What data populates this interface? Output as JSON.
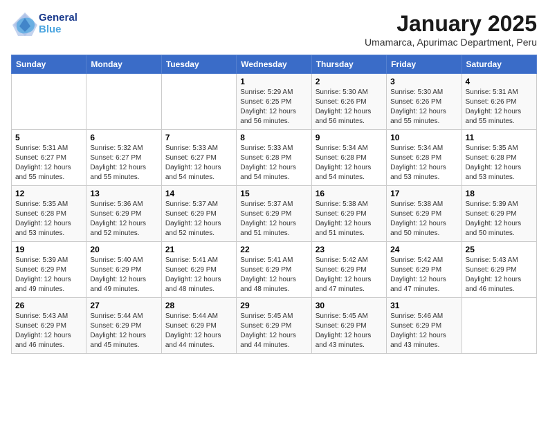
{
  "logo": {
    "line1": "General",
    "line2": "Blue"
  },
  "title": "January 2025",
  "subtitle": "Umamarca, Apurimac Department, Peru",
  "days_of_week": [
    "Sunday",
    "Monday",
    "Tuesday",
    "Wednesday",
    "Thursday",
    "Friday",
    "Saturday"
  ],
  "weeks": [
    [
      {
        "day": "",
        "detail": ""
      },
      {
        "day": "",
        "detail": ""
      },
      {
        "day": "",
        "detail": ""
      },
      {
        "day": "1",
        "detail": "Sunrise: 5:29 AM\nSunset: 6:25 PM\nDaylight: 12 hours\nand 56 minutes."
      },
      {
        "day": "2",
        "detail": "Sunrise: 5:30 AM\nSunset: 6:26 PM\nDaylight: 12 hours\nand 56 minutes."
      },
      {
        "day": "3",
        "detail": "Sunrise: 5:30 AM\nSunset: 6:26 PM\nDaylight: 12 hours\nand 55 minutes."
      },
      {
        "day": "4",
        "detail": "Sunrise: 5:31 AM\nSunset: 6:26 PM\nDaylight: 12 hours\nand 55 minutes."
      }
    ],
    [
      {
        "day": "5",
        "detail": "Sunrise: 5:31 AM\nSunset: 6:27 PM\nDaylight: 12 hours\nand 55 minutes."
      },
      {
        "day": "6",
        "detail": "Sunrise: 5:32 AM\nSunset: 6:27 PM\nDaylight: 12 hours\nand 55 minutes."
      },
      {
        "day": "7",
        "detail": "Sunrise: 5:33 AM\nSunset: 6:27 PM\nDaylight: 12 hours\nand 54 minutes."
      },
      {
        "day": "8",
        "detail": "Sunrise: 5:33 AM\nSunset: 6:28 PM\nDaylight: 12 hours\nand 54 minutes."
      },
      {
        "day": "9",
        "detail": "Sunrise: 5:34 AM\nSunset: 6:28 PM\nDaylight: 12 hours\nand 54 minutes."
      },
      {
        "day": "10",
        "detail": "Sunrise: 5:34 AM\nSunset: 6:28 PM\nDaylight: 12 hours\nand 53 minutes."
      },
      {
        "day": "11",
        "detail": "Sunrise: 5:35 AM\nSunset: 6:28 PM\nDaylight: 12 hours\nand 53 minutes."
      }
    ],
    [
      {
        "day": "12",
        "detail": "Sunrise: 5:35 AM\nSunset: 6:28 PM\nDaylight: 12 hours\nand 53 minutes."
      },
      {
        "day": "13",
        "detail": "Sunrise: 5:36 AM\nSunset: 6:29 PM\nDaylight: 12 hours\nand 52 minutes."
      },
      {
        "day": "14",
        "detail": "Sunrise: 5:37 AM\nSunset: 6:29 PM\nDaylight: 12 hours\nand 52 minutes."
      },
      {
        "day": "15",
        "detail": "Sunrise: 5:37 AM\nSunset: 6:29 PM\nDaylight: 12 hours\nand 51 minutes."
      },
      {
        "day": "16",
        "detail": "Sunrise: 5:38 AM\nSunset: 6:29 PM\nDaylight: 12 hours\nand 51 minutes."
      },
      {
        "day": "17",
        "detail": "Sunrise: 5:38 AM\nSunset: 6:29 PM\nDaylight: 12 hours\nand 50 minutes."
      },
      {
        "day": "18",
        "detail": "Sunrise: 5:39 AM\nSunset: 6:29 PM\nDaylight: 12 hours\nand 50 minutes."
      }
    ],
    [
      {
        "day": "19",
        "detail": "Sunrise: 5:39 AM\nSunset: 6:29 PM\nDaylight: 12 hours\nand 49 minutes."
      },
      {
        "day": "20",
        "detail": "Sunrise: 5:40 AM\nSunset: 6:29 PM\nDaylight: 12 hours\nand 49 minutes."
      },
      {
        "day": "21",
        "detail": "Sunrise: 5:41 AM\nSunset: 6:29 PM\nDaylight: 12 hours\nand 48 minutes."
      },
      {
        "day": "22",
        "detail": "Sunrise: 5:41 AM\nSunset: 6:29 PM\nDaylight: 12 hours\nand 48 minutes."
      },
      {
        "day": "23",
        "detail": "Sunrise: 5:42 AM\nSunset: 6:29 PM\nDaylight: 12 hours\nand 47 minutes."
      },
      {
        "day": "24",
        "detail": "Sunrise: 5:42 AM\nSunset: 6:29 PM\nDaylight: 12 hours\nand 47 minutes."
      },
      {
        "day": "25",
        "detail": "Sunrise: 5:43 AM\nSunset: 6:29 PM\nDaylight: 12 hours\nand 46 minutes."
      }
    ],
    [
      {
        "day": "26",
        "detail": "Sunrise: 5:43 AM\nSunset: 6:29 PM\nDaylight: 12 hours\nand 46 minutes."
      },
      {
        "day": "27",
        "detail": "Sunrise: 5:44 AM\nSunset: 6:29 PM\nDaylight: 12 hours\nand 45 minutes."
      },
      {
        "day": "28",
        "detail": "Sunrise: 5:44 AM\nSunset: 6:29 PM\nDaylight: 12 hours\nand 44 minutes."
      },
      {
        "day": "29",
        "detail": "Sunrise: 5:45 AM\nSunset: 6:29 PM\nDaylight: 12 hours\nand 44 minutes."
      },
      {
        "day": "30",
        "detail": "Sunrise: 5:45 AM\nSunset: 6:29 PM\nDaylight: 12 hours\nand 43 minutes."
      },
      {
        "day": "31",
        "detail": "Sunrise: 5:46 AM\nSunset: 6:29 PM\nDaylight: 12 hours\nand 43 minutes."
      },
      {
        "day": "",
        "detail": ""
      }
    ]
  ]
}
